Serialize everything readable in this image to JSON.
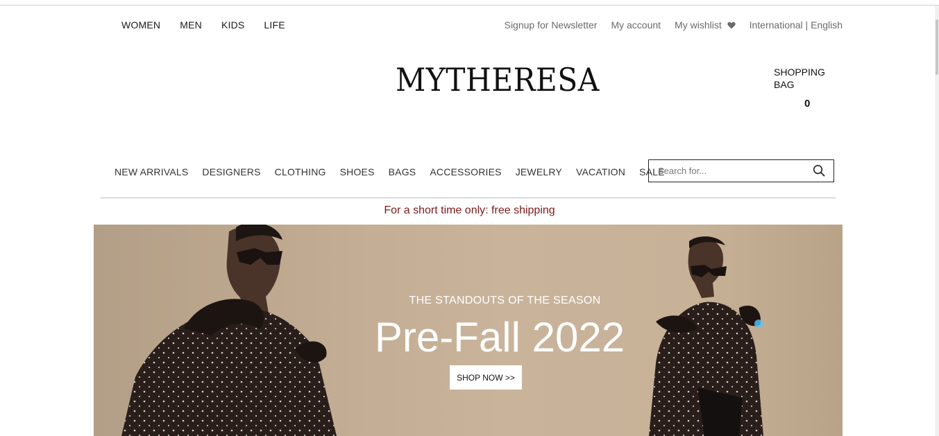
{
  "departments": [
    "WOMEN",
    "MEN",
    "KIDS",
    "LIFE"
  ],
  "utility": {
    "newsletter": "Signup for Newsletter",
    "account": "My account",
    "wishlist": "My wishlist",
    "region": "International | English"
  },
  "logo_text": "MYTHERESA",
  "bag": {
    "label": "SHOPPING BAG",
    "count": "0"
  },
  "categories": [
    "NEW ARRIVALS",
    "DESIGNERS",
    "CLOTHING",
    "SHOES",
    "BAGS",
    "ACCESSORIES",
    "JEWELRY",
    "VACATION",
    "SALE"
  ],
  "search": {
    "placeholder": "Search for..."
  },
  "promo": "For a short time only: free shipping",
  "hero": {
    "kicker": "THE STANDOUTS OF THE SEASON",
    "title": "Pre-Fall 2022",
    "button": "SHOP NOW >>"
  },
  "colors": {
    "promo_text": "#7b1a1a",
    "hero_background": "#c3ad94",
    "text_dark": "#1a1a1a"
  },
  "icons": [
    "heart-icon",
    "search-icon"
  ]
}
